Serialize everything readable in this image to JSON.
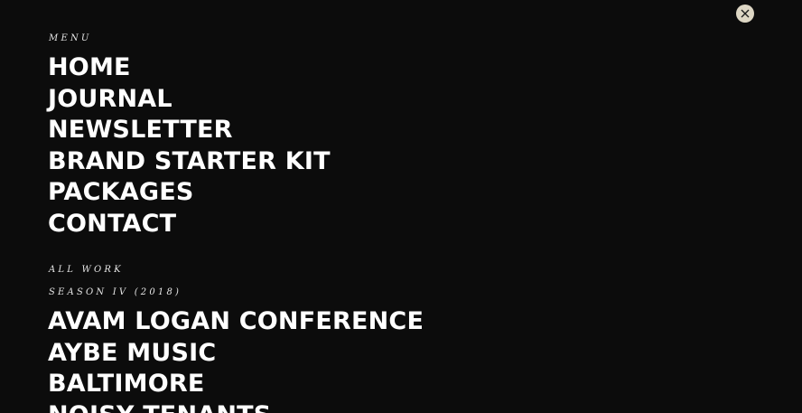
{
  "close_icon": "close-icon",
  "menu": {
    "label": "MENU",
    "items": [
      "HOME",
      "JOURNAL",
      "NEWSLETTER",
      "BRAND STARTER KIT",
      "PACKAGES",
      "CONTACT"
    ]
  },
  "work": {
    "all_work_label": "ALL WORK",
    "season_label": "SEASON IV (2018)",
    "items": [
      "AVAM LOGAN CONFERENCE",
      "AYBE MUSIC",
      "BALTIMORE",
      "NOISY TENANTS"
    ]
  },
  "colors": {
    "background": "#0c0c0c",
    "text": "#ffffff",
    "close_button": "#ddd6c4"
  }
}
